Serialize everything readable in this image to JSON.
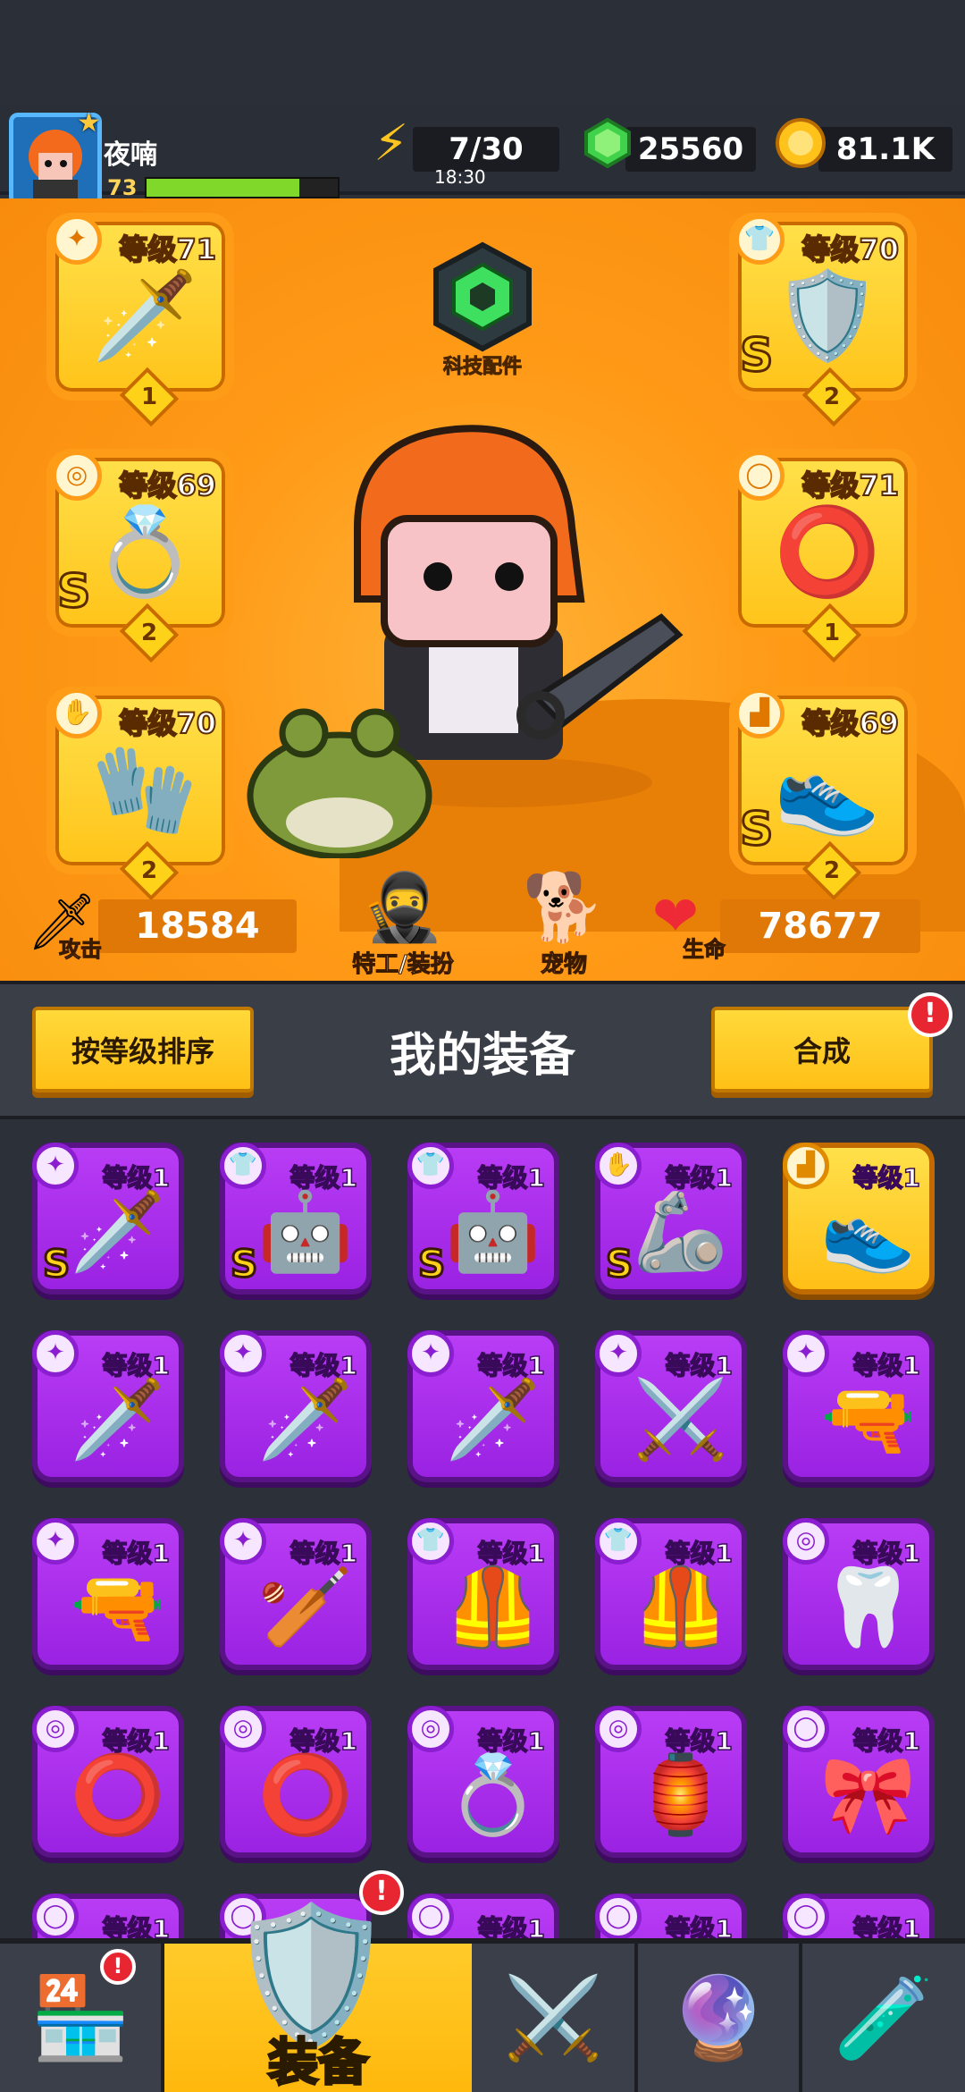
{
  "player": {
    "name": "夜喃",
    "level": "73",
    "xp_fraction": 0.8
  },
  "resources": {
    "energy": "7/30",
    "energy_timer": "18:30",
    "gems": "25560",
    "coins": "81.1K"
  },
  "hero": {
    "tech_label": "科技配件",
    "attack_label": "攻击",
    "attack_value": "18584",
    "hp_label": "生命",
    "hp_value": "78677",
    "agent_label": "特工/装扮",
    "pet_label": "宠物"
  },
  "equipped": [
    {
      "level": "等级71",
      "count": "1",
      "rank": ""
    },
    {
      "level": "等级69",
      "count": "2",
      "rank": "S"
    },
    {
      "level": "等级70",
      "count": "2",
      "rank": ""
    },
    {
      "level": "等级70",
      "count": "2",
      "rank": "S"
    },
    {
      "level": "等级71",
      "count": "1",
      "rank": ""
    },
    {
      "level": "等级69",
      "count": "2",
      "rank": "S"
    }
  ],
  "equip_bar": {
    "sort_label": "按等级排序",
    "title": "我的装备",
    "merge_label": "合成",
    "alert": "!"
  },
  "inventory": {
    "level_text": "等级1",
    "items": [
      {
        "rank": "S",
        "gold": false
      },
      {
        "rank": "S",
        "gold": false
      },
      {
        "rank": "S",
        "gold": false
      },
      {
        "rank": "S",
        "gold": false
      },
      {
        "rank": "",
        "gold": true
      },
      {
        "rank": "",
        "gold": false
      },
      {
        "rank": "",
        "gold": false
      },
      {
        "rank": "",
        "gold": false
      },
      {
        "rank": "",
        "gold": false
      },
      {
        "rank": "",
        "gold": false
      },
      {
        "rank": "",
        "gold": false
      },
      {
        "rank": "",
        "gold": false
      },
      {
        "rank": "",
        "gold": false
      },
      {
        "rank": "",
        "gold": false
      },
      {
        "rank": "",
        "gold": false
      },
      {
        "rank": "",
        "gold": false
      },
      {
        "rank": "",
        "gold": false
      },
      {
        "rank": "",
        "gold": false
      },
      {
        "rank": "",
        "gold": false
      },
      {
        "rank": "",
        "gold": false
      },
      {
        "rank": "",
        "gold": false
      },
      {
        "rank": "",
        "gold": false
      },
      {
        "rank": "",
        "gold": false
      },
      {
        "rank": "",
        "gold": false
      },
      {
        "rank": "",
        "gold": false
      }
    ]
  },
  "nav": {
    "active_label": "装备",
    "alert": "!"
  }
}
